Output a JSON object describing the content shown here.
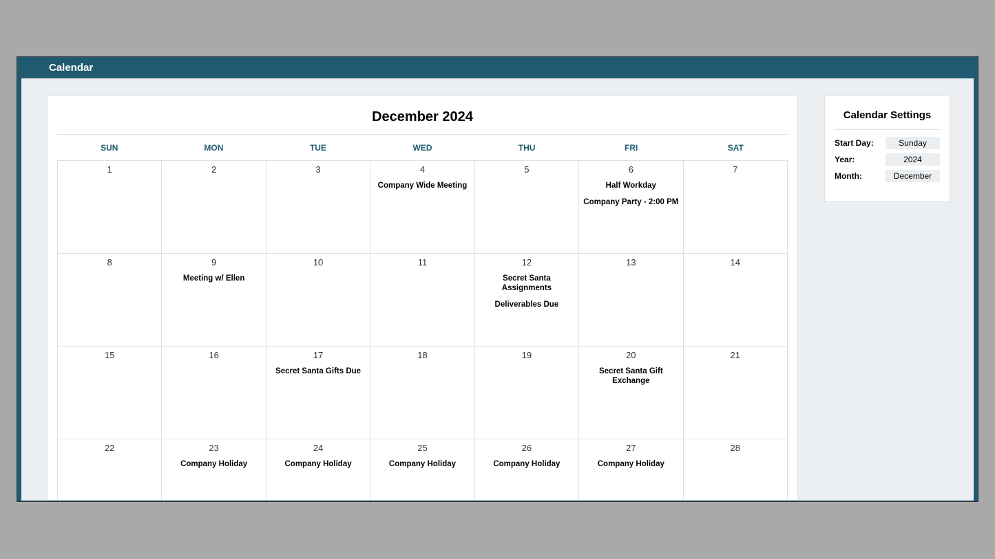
{
  "titlebar": {
    "label": "Calendar"
  },
  "calendar": {
    "heading": "December 2024",
    "day_headers": [
      "SUN",
      "MON",
      "TUE",
      "WED",
      "THU",
      "FRI",
      "SAT"
    ],
    "weeks": [
      [
        {
          "num": "1",
          "events": []
        },
        {
          "num": "2",
          "events": []
        },
        {
          "num": "3",
          "events": []
        },
        {
          "num": "4",
          "events": [
            "Company Wide Meeting"
          ]
        },
        {
          "num": "5",
          "events": []
        },
        {
          "num": "6",
          "events": [
            "Half Workday",
            "Company Party - 2:00 PM"
          ]
        },
        {
          "num": "7",
          "events": []
        }
      ],
      [
        {
          "num": "8",
          "events": []
        },
        {
          "num": "9",
          "events": [
            "Meeting w/ Ellen"
          ]
        },
        {
          "num": "10",
          "events": []
        },
        {
          "num": "11",
          "events": []
        },
        {
          "num": "12",
          "events": [
            "Secret Santa Assignments",
            "Deliverables Due"
          ]
        },
        {
          "num": "13",
          "events": []
        },
        {
          "num": "14",
          "events": []
        }
      ],
      [
        {
          "num": "15",
          "events": []
        },
        {
          "num": "16",
          "events": []
        },
        {
          "num": "17",
          "events": [
            "Secret Santa Gifts Due"
          ]
        },
        {
          "num": "18",
          "events": []
        },
        {
          "num": "19",
          "events": []
        },
        {
          "num": "20",
          "events": [
            "Secret Santa Gift Exchange"
          ]
        },
        {
          "num": "21",
          "events": []
        }
      ],
      [
        {
          "num": "22",
          "events": []
        },
        {
          "num": "23",
          "events": [
            "Company Holiday"
          ]
        },
        {
          "num": "24",
          "events": [
            "Company Holiday"
          ]
        },
        {
          "num": "25",
          "events": [
            "Company Holiday"
          ]
        },
        {
          "num": "26",
          "events": [
            "Company Holiday"
          ]
        },
        {
          "num": "27",
          "events": [
            "Company Holiday"
          ]
        },
        {
          "num": "28",
          "events": []
        }
      ]
    ]
  },
  "settings": {
    "title": "Calendar Settings",
    "rows": [
      {
        "label": "Start Day:",
        "value": "Sunday"
      },
      {
        "label": "Year:",
        "value": "2024"
      },
      {
        "label": "Month:",
        "value": "December"
      }
    ]
  }
}
